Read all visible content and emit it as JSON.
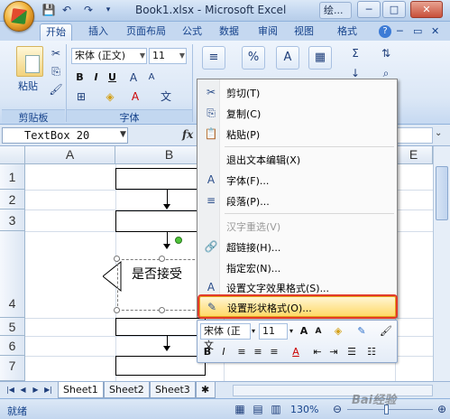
{
  "window": {
    "title": "Book1.xlsx - Microsoft Excel",
    "extra_window": "绘...",
    "minimize": "─",
    "maximize": "□",
    "close": "✕"
  },
  "qat": {
    "save": "💾",
    "undo": "↶",
    "redo": "↷"
  },
  "tabs": [
    "开始",
    "插入",
    "页面布局",
    "公式",
    "数据",
    "审阅",
    "视图",
    "格式"
  ],
  "tab_help": "?",
  "ribbon": {
    "clipboard": {
      "paste_label": "粘贴",
      "group_label": "剪贴板"
    },
    "font": {
      "name": "宋体 (正文)",
      "size": "11",
      "bold": "B",
      "italic": "I",
      "underline": "U",
      "group_label": "字体"
    },
    "more_icons": {
      "align": "≡",
      "percent": "%",
      "styles": "A",
      "sigma": "Σ"
    }
  },
  "formula_bar": {
    "name_box": "TextBox 20",
    "fx": "fx"
  },
  "columns": [
    "A",
    "B",
    "E"
  ],
  "rows": [
    "1",
    "2",
    "3",
    "4",
    "5",
    "6",
    "7"
  ],
  "shape": {
    "decision_text": "是否接受"
  },
  "context_menu": [
    {
      "icon": "cut-icon",
      "glyph": "✂",
      "label": "剪切(T)",
      "disabled": false,
      "highlight": false
    },
    {
      "icon": "copy-icon",
      "glyph": "⎘",
      "label": "复制(C)",
      "disabled": false,
      "highlight": false
    },
    {
      "icon": "paste-icon",
      "glyph": "📋",
      "label": "粘贴(P)",
      "disabled": false,
      "highlight": false
    },
    {
      "icon": "",
      "glyph": "",
      "label": "退出文本编辑(X)",
      "disabled": false,
      "highlight": false
    },
    {
      "icon": "font-icon",
      "glyph": "A",
      "label": "字体(F)...",
      "disabled": false,
      "highlight": false
    },
    {
      "icon": "paragraph-icon",
      "glyph": "≡",
      "label": "段落(P)...",
      "disabled": false,
      "highlight": false
    },
    {
      "icon": "",
      "glyph": "",
      "label": "汉字重选(V)",
      "disabled": true,
      "highlight": false
    },
    {
      "icon": "hyperlink-icon",
      "glyph": "🔗",
      "label": "超链接(H)...",
      "disabled": false,
      "highlight": false
    },
    {
      "icon": "",
      "glyph": "",
      "label": "指定宏(N)...",
      "disabled": false,
      "highlight": false
    },
    {
      "icon": "text-effects-icon",
      "glyph": "A",
      "label": "设置文字效果格式(S)...",
      "disabled": false,
      "highlight": false
    },
    {
      "icon": "shape-format-icon",
      "glyph": "✎",
      "label": "设置形状格式(O)...",
      "disabled": false,
      "highlight": true
    }
  ],
  "mini_toolbar": {
    "font": "宋体 (正文",
    "size": "11",
    "grow": "A",
    "shrink": "A",
    "bold": "B",
    "italic": "I",
    "font_color": "A"
  },
  "sheets": [
    "Sheet1",
    "Sheet2",
    "Sheet3"
  ],
  "status": {
    "ready": "就绪",
    "zoom": "130%"
  },
  "watermark": "Bai经验"
}
